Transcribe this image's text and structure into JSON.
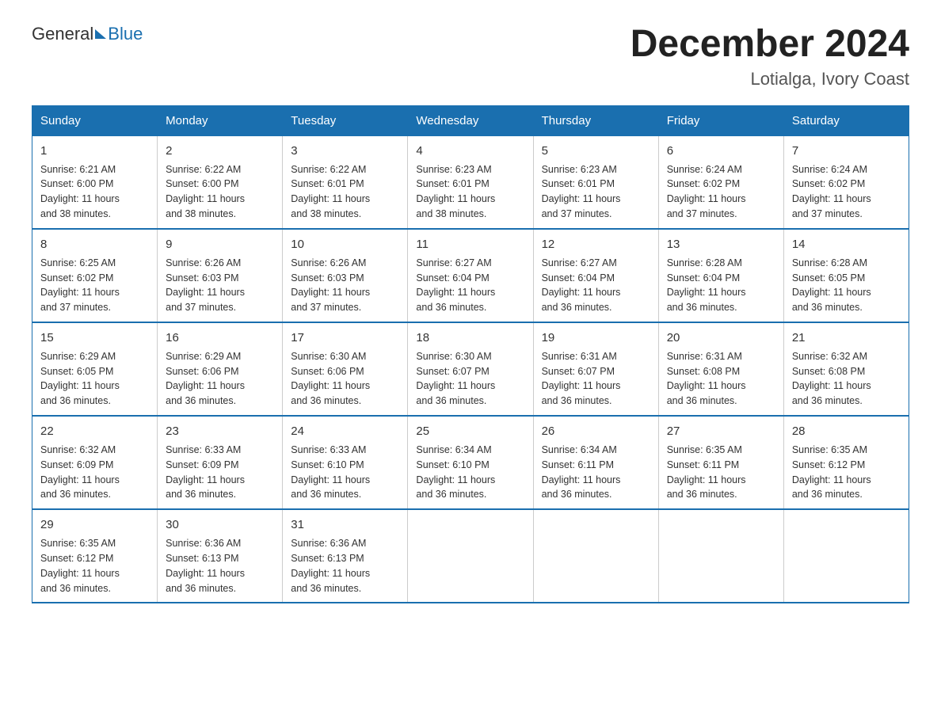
{
  "header": {
    "logo_general": "General",
    "logo_blue": "Blue",
    "title": "December 2024",
    "subtitle": "Lotialga, Ivory Coast"
  },
  "weekdays": [
    "Sunday",
    "Monday",
    "Tuesday",
    "Wednesday",
    "Thursday",
    "Friday",
    "Saturday"
  ],
  "weeks": [
    [
      {
        "day": "1",
        "sunrise": "6:21 AM",
        "sunset": "6:00 PM",
        "daylight": "11 hours and 38 minutes."
      },
      {
        "day": "2",
        "sunrise": "6:22 AM",
        "sunset": "6:00 PM",
        "daylight": "11 hours and 38 minutes."
      },
      {
        "day": "3",
        "sunrise": "6:22 AM",
        "sunset": "6:01 PM",
        "daylight": "11 hours and 38 minutes."
      },
      {
        "day": "4",
        "sunrise": "6:23 AM",
        "sunset": "6:01 PM",
        "daylight": "11 hours and 38 minutes."
      },
      {
        "day": "5",
        "sunrise": "6:23 AM",
        "sunset": "6:01 PM",
        "daylight": "11 hours and 37 minutes."
      },
      {
        "day": "6",
        "sunrise": "6:24 AM",
        "sunset": "6:02 PM",
        "daylight": "11 hours and 37 minutes."
      },
      {
        "day": "7",
        "sunrise": "6:24 AM",
        "sunset": "6:02 PM",
        "daylight": "11 hours and 37 minutes."
      }
    ],
    [
      {
        "day": "8",
        "sunrise": "6:25 AM",
        "sunset": "6:02 PM",
        "daylight": "11 hours and 37 minutes."
      },
      {
        "day": "9",
        "sunrise": "6:26 AM",
        "sunset": "6:03 PM",
        "daylight": "11 hours and 37 minutes."
      },
      {
        "day": "10",
        "sunrise": "6:26 AM",
        "sunset": "6:03 PM",
        "daylight": "11 hours and 37 minutes."
      },
      {
        "day": "11",
        "sunrise": "6:27 AM",
        "sunset": "6:04 PM",
        "daylight": "11 hours and 36 minutes."
      },
      {
        "day": "12",
        "sunrise": "6:27 AM",
        "sunset": "6:04 PM",
        "daylight": "11 hours and 36 minutes."
      },
      {
        "day": "13",
        "sunrise": "6:28 AM",
        "sunset": "6:04 PM",
        "daylight": "11 hours and 36 minutes."
      },
      {
        "day": "14",
        "sunrise": "6:28 AM",
        "sunset": "6:05 PM",
        "daylight": "11 hours and 36 minutes."
      }
    ],
    [
      {
        "day": "15",
        "sunrise": "6:29 AM",
        "sunset": "6:05 PM",
        "daylight": "11 hours and 36 minutes."
      },
      {
        "day": "16",
        "sunrise": "6:29 AM",
        "sunset": "6:06 PM",
        "daylight": "11 hours and 36 minutes."
      },
      {
        "day": "17",
        "sunrise": "6:30 AM",
        "sunset": "6:06 PM",
        "daylight": "11 hours and 36 minutes."
      },
      {
        "day": "18",
        "sunrise": "6:30 AM",
        "sunset": "6:07 PM",
        "daylight": "11 hours and 36 minutes."
      },
      {
        "day": "19",
        "sunrise": "6:31 AM",
        "sunset": "6:07 PM",
        "daylight": "11 hours and 36 minutes."
      },
      {
        "day": "20",
        "sunrise": "6:31 AM",
        "sunset": "6:08 PM",
        "daylight": "11 hours and 36 minutes."
      },
      {
        "day": "21",
        "sunrise": "6:32 AM",
        "sunset": "6:08 PM",
        "daylight": "11 hours and 36 minutes."
      }
    ],
    [
      {
        "day": "22",
        "sunrise": "6:32 AM",
        "sunset": "6:09 PM",
        "daylight": "11 hours and 36 minutes."
      },
      {
        "day": "23",
        "sunrise": "6:33 AM",
        "sunset": "6:09 PM",
        "daylight": "11 hours and 36 minutes."
      },
      {
        "day": "24",
        "sunrise": "6:33 AM",
        "sunset": "6:10 PM",
        "daylight": "11 hours and 36 minutes."
      },
      {
        "day": "25",
        "sunrise": "6:34 AM",
        "sunset": "6:10 PM",
        "daylight": "11 hours and 36 minutes."
      },
      {
        "day": "26",
        "sunrise": "6:34 AM",
        "sunset": "6:11 PM",
        "daylight": "11 hours and 36 minutes."
      },
      {
        "day": "27",
        "sunrise": "6:35 AM",
        "sunset": "6:11 PM",
        "daylight": "11 hours and 36 minutes."
      },
      {
        "day": "28",
        "sunrise": "6:35 AM",
        "sunset": "6:12 PM",
        "daylight": "11 hours and 36 minutes."
      }
    ],
    [
      {
        "day": "29",
        "sunrise": "6:35 AM",
        "sunset": "6:12 PM",
        "daylight": "11 hours and 36 minutes."
      },
      {
        "day": "30",
        "sunrise": "6:36 AM",
        "sunset": "6:13 PM",
        "daylight": "11 hours and 36 minutes."
      },
      {
        "day": "31",
        "sunrise": "6:36 AM",
        "sunset": "6:13 PM",
        "daylight": "11 hours and 36 minutes."
      },
      null,
      null,
      null,
      null
    ]
  ]
}
